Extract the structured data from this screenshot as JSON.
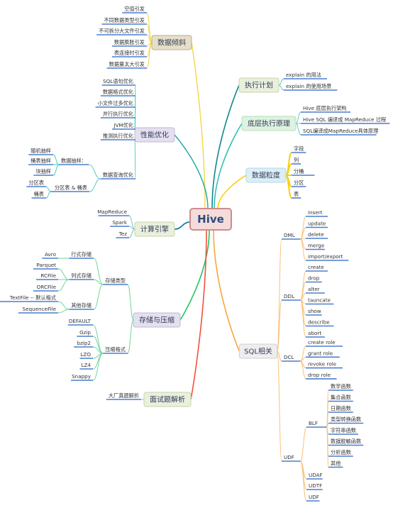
{
  "root": {
    "label": "Hive",
    "fill": "#f4dcdc",
    "stroke": "#d08a8a"
  },
  "branches": [
    {
      "id": "data-skew",
      "label": "数据倾斜",
      "side": "left",
      "color": "#f5d547",
      "box": "#e6dfc8",
      "boxStroke": "#b8ae8c",
      "children": [
        {
          "label": "空值引发"
        },
        {
          "label": "不同数据类型引发"
        },
        {
          "label": "不可拆分大文件引发"
        },
        {
          "label": "数据膨胀引发"
        },
        {
          "label": "表连接时引发"
        },
        {
          "label": "数据量太大引发"
        }
      ]
    },
    {
      "id": "performance",
      "label": "性能优化",
      "side": "left",
      "color": "#4fd1c1",
      "box": "#e4e0ee",
      "boxStroke": "#c0b8d6",
      "children": [
        {
          "label": "SQL语句优化"
        },
        {
          "label": "数据格式优化"
        },
        {
          "label": "小文件过多优化"
        },
        {
          "label": "并行执行优化"
        },
        {
          "label": "JVM优化"
        },
        {
          "label": "推测执行优化"
        },
        {
          "label": "数据查询优化",
          "children": [
            {
              "label": "数据抽样：",
              "children": [
                {
                  "label": "随机抽样"
                },
                {
                  "label": "桶表抽样"
                },
                {
                  "label": "块抽样"
                }
              ]
            },
            {
              "label": "分区表 & 桶表",
              "children": [
                {
                  "label": "分区表"
                },
                {
                  "label": "桶表"
                }
              ]
            }
          ]
        }
      ]
    },
    {
      "id": "engine",
      "label": "计算引擎",
      "side": "left",
      "color": "#1f7fa0",
      "box": "#e9f0dc",
      "boxStroke": "#c6d4ad",
      "children": [
        {
          "label": "MapReduce"
        },
        {
          "label": "Spark"
        },
        {
          "label": "Tez"
        }
      ]
    },
    {
      "id": "storage",
      "label": "存储与压缩",
      "side": "left",
      "color": "#22c55e",
      "box": "#e4e0ee",
      "boxStroke": "#c0b8d6",
      "children": [
        {
          "label": "存储类型",
          "children": [
            {
              "label": "行式存储",
              "children": [
                {
                  "label": "Avro"
                }
              ]
            },
            {
              "label": "列式存储",
              "children": [
                {
                  "label": "Parquet"
                },
                {
                  "label": "RCFile"
                },
                {
                  "label": "ORCFile"
                }
              ]
            },
            {
              "label": "其他存储",
              "children": [
                {
                  "label": "TextFile -- 默认格式"
                },
                {
                  "label": "SequenceFile"
                }
              ]
            }
          ]
        },
        {
          "label": "压缩格式",
          "children": [
            {
              "label": "DEFAULT"
            },
            {
              "label": "Gzip"
            },
            {
              "label": "bzip2"
            },
            {
              "label": "LZO"
            },
            {
              "label": "LZ4"
            },
            {
              "label": "Snappy"
            }
          ]
        }
      ]
    },
    {
      "id": "interview",
      "label": "面试题解析",
      "side": "left",
      "color": "#f0503c",
      "box": "#e9f0dc",
      "boxStroke": "#c6d4ad",
      "children": [
        {
          "label": "大厂真题解析"
        }
      ]
    },
    {
      "id": "exec-plan",
      "label": "执行计划",
      "side": "right",
      "color": "#10888f",
      "box": "#e9f0dc",
      "boxStroke": "#c6d4ad",
      "children": [
        {
          "label": "explain 的用法"
        },
        {
          "label": "explain 的使用场景"
        }
      ]
    },
    {
      "id": "exec-principle",
      "label": "底层执行原理",
      "side": "right",
      "color": "#33c2b5",
      "box": "#def2e0",
      "boxStroke": "#b6dcba",
      "children": [
        {
          "label": "Hive 底层执行架构"
        },
        {
          "label": "Hive SQL 编译成 MapReduce 过程"
        },
        {
          "label": "SQL编译成MapReduce具体原理"
        }
      ]
    },
    {
      "id": "granularity",
      "label": "数据粒度",
      "side": "right",
      "color": "#f9cf10",
      "box": "#dceef6",
      "boxStroke": "#b4d6e4",
      "children": [
        {
          "label": "字段"
        },
        {
          "label": "列"
        },
        {
          "label": "分桶"
        },
        {
          "label": "分区"
        },
        {
          "label": "表"
        }
      ]
    },
    {
      "id": "sql",
      "label": "SQL相关",
      "side": "right",
      "color": "#f7a63c",
      "box": "#eeeeee",
      "boxStroke": "#d0d0d0",
      "children": [
        {
          "label": "DML",
          "children": [
            {
              "label": "insert"
            },
            {
              "label": "update"
            },
            {
              "label": "delete"
            },
            {
              "label": "merge"
            },
            {
              "label": "import/export"
            }
          ]
        },
        {
          "label": "DDL",
          "children": [
            {
              "label": "create"
            },
            {
              "label": "drop"
            },
            {
              "label": "alter"
            },
            {
              "label": "tauncate"
            },
            {
              "label": "show"
            },
            {
              "label": "describe"
            },
            {
              "label": "abort"
            }
          ]
        },
        {
          "label": "DCL",
          "children": [
            {
              "label": "create role"
            },
            {
              "label": "grant role"
            },
            {
              "label": "revoke role"
            },
            {
              "label": "drop role"
            }
          ]
        },
        {
          "label": "UDF",
          "children": [
            {
              "label": "BLF",
              "children": [
                {
                  "label": "数学函数"
                },
                {
                  "label": "集合函数"
                },
                {
                  "label": "日期函数"
                },
                {
                  "label": "类型转换函数"
                },
                {
                  "label": "字符串函数"
                },
                {
                  "label": "数据脱敏函数"
                },
                {
                  "label": "分析函数"
                },
                {
                  "label": "其他"
                }
              ]
            },
            {
              "label": "UDAF"
            },
            {
              "label": "UDTF"
            },
            {
              "label": "UDF"
            }
          ]
        }
      ]
    }
  ],
  "colors": {
    "underline": "#4a7fd0",
    "text": "#333333"
  }
}
